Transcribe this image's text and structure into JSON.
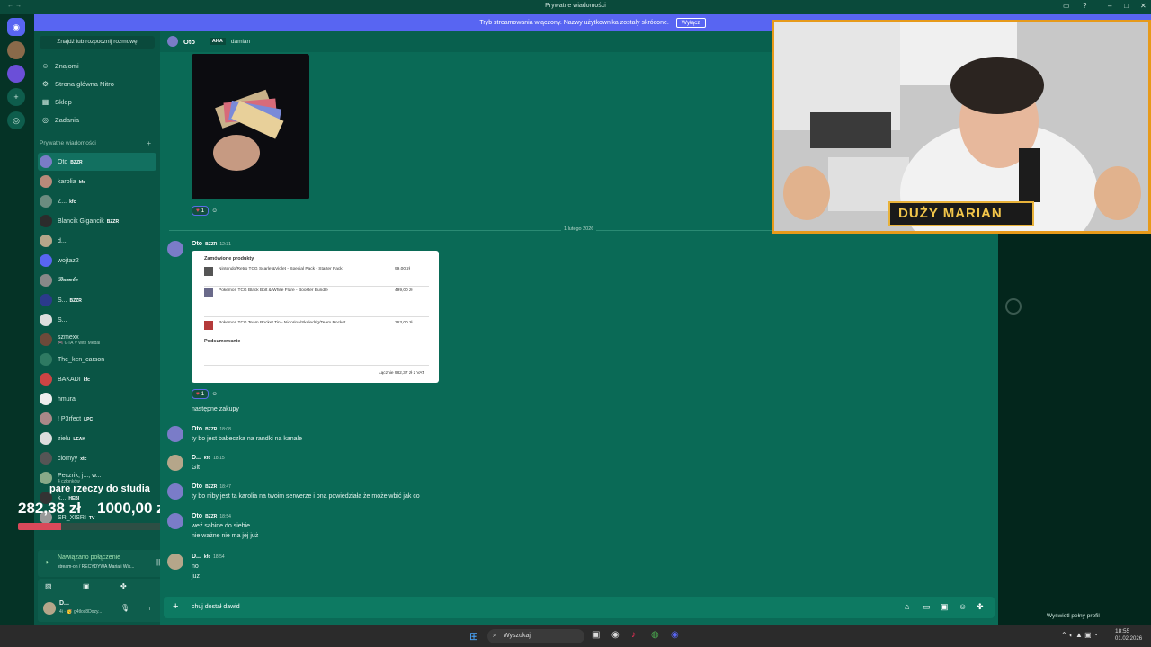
{
  "titlebar": {
    "title": "Prywatne wiadomości"
  },
  "stream_bar": {
    "text": "Tryb streamowania włączony. Nazwy użytkownika zostały skrócone.",
    "button": "Wyłącz"
  },
  "sidebar": {
    "search": "Znajdź lub rozpocznij rozmowę",
    "nav": [
      {
        "label": "Znajomi"
      },
      {
        "label": "Strona główna Nitro"
      },
      {
        "label": "Sklep"
      },
      {
        "label": "Zadania"
      }
    ],
    "dm_header": "Prywatne wiadomości",
    "dms": [
      {
        "name": "Oto",
        "tag": "BZZR",
        "color": "#7a7cc8"
      },
      {
        "name": "karolia",
        "tag": "kfc",
        "color": "#b88a7a"
      },
      {
        "name": "Z...",
        "tag": "kfc",
        "color": "#6b8c80"
      },
      {
        "name": "Blancik Gigancik",
        "tag": "BZZR",
        "color": "#2c2c2c"
      },
      {
        "name": "d...",
        "tag": "",
        "color": "#b5a68a"
      },
      {
        "name": "wojtaz2",
        "tag": "",
        "color": "#5865f2"
      },
      {
        "name": "𝓑𝓪𝓶𝓫𝓸",
        "tag": "",
        "color": "#888"
      },
      {
        "name": "S...",
        "tag": "BZZR",
        "color": "#2b3a8c"
      },
      {
        "name": "S...",
        "tag": "",
        "color": "#ddd"
      },
      {
        "name": "szmexx",
        "sub": "🎮 GTA V with Medal",
        "tag": "",
        "color": "#6d4a3a"
      },
      {
        "name": "The_ken_carson",
        "tag": "",
        "color": "#2e7a62"
      },
      {
        "name": "BAKADI",
        "tag": "kfc",
        "color": "#c44"
      },
      {
        "name": "hmura",
        "tag": "",
        "color": "#eee"
      },
      {
        "name": "! P3rfect",
        "tag": "LPC",
        "color": "#a88"
      },
      {
        "name": "zielu",
        "tag": "LEAK",
        "color": "#ddd"
      },
      {
        "name": "ciornyy",
        "tag": "xtc",
        "color": "#555"
      },
      {
        "name": "Peczrik, j..., w...",
        "sub": "4 członków",
        "tag": "",
        "color": "#8a8"
      },
      {
        "name": "k...",
        "tag": "HEBI",
        "color": "#333"
      },
      {
        "name": "SR_XISRI",
        "tag": "TV",
        "color": "#999"
      }
    ],
    "voice": {
      "status": "Nawiązano połączenie",
      "channel": "stream-on / RECYDYWA Maria i Wik..."
    },
    "user": {
      "name": "D...",
      "status": "4i · 🥳 g4tlos8Dozy..."
    }
  },
  "goal": {
    "title": "pare rzeczy do studia",
    "current": "282,38 zł",
    "target": "1000,00 zł",
    "progress": 0.28
  },
  "chat": {
    "header": {
      "name": "Oto",
      "aka_label": "AKA",
      "aka": "damian"
    },
    "date_sep": "1 lutego 2026",
    "reaction_count": "1",
    "messages": [
      {
        "name": "Oto",
        "tag": "BZZR",
        "time": "12:31",
        "text": ""
      },
      {
        "name": "",
        "tag": "",
        "time": "",
        "text": "następne zakupy"
      },
      {
        "name": "Oto",
        "tag": "BZZR",
        "time": "18:08",
        "text": "ty bo jest babeczka na randki na kanale"
      },
      {
        "name": "D...",
        "tag": "kfc",
        "time": "18:15",
        "text": "Git"
      },
      {
        "name": "Oto",
        "tag": "BZZR",
        "time": "18:47",
        "text": "ty bo niby jest ta karolia na twoim serwerze i ona powiedziała że może wbić jak co"
      },
      {
        "name": "Oto",
        "tag": "BZZR",
        "time": "18:54",
        "text": "weź sabine do siebie"
      },
      {
        "name": "",
        "tag": "",
        "time": "",
        "text": "nie ważne nie ma jej już"
      },
      {
        "name": "D...",
        "tag": "kfc",
        "time": "18:54",
        "text": "no"
      },
      {
        "name": "",
        "tag": "",
        "time": "",
        "text": "juz"
      }
    ],
    "receipt": {
      "title": "Zamówione produkty",
      "items": [
        {
          "name": "Nintendo/Retro TCG Scarlet&Violet - Special Pack - Starter Pack",
          "price": "99,00 zł"
        },
        {
          "name": "Pokemon TCG Black Bolt & White Flare - Booster Bundle",
          "price": "499,00 zł"
        },
        {
          "name": "Pokemon TCG Team Rocket Tin - Nidorina/Skeledrig/Team Rocket",
          "price": "363,00 zł"
        }
      ],
      "summary_title": "Podsumowanie",
      "total": "Łącznie 982,37 zł z VAT"
    },
    "composer": {
      "text": "chuj dostał dawid"
    }
  },
  "webcam": {
    "label": "DUŻY MARIAN"
  },
  "profile": {
    "button": "Wyświetl pełny profil"
  },
  "taskbar": {
    "search": "Wyszukaj",
    "time": "18:55",
    "date": "01.02.2026"
  }
}
